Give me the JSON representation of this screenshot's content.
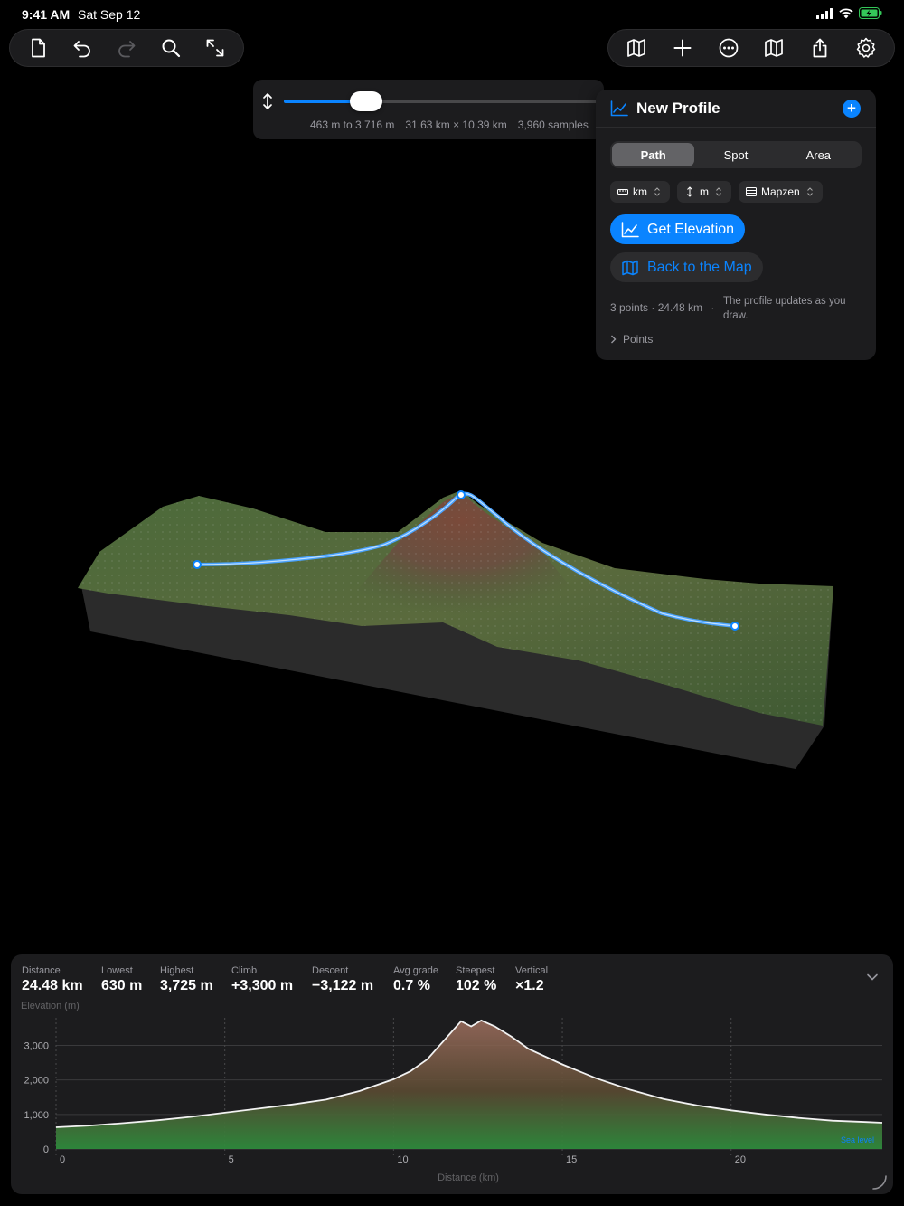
{
  "status_bar": {
    "time": "9:41 AM",
    "date": "Sat Sep 12"
  },
  "toolbar_left": {
    "icons": [
      "document-icon",
      "undo-icon",
      "redo-icon",
      "search-icon",
      "expand-icon"
    ]
  },
  "toolbar_right": {
    "icons": [
      "map-icon",
      "add-icon",
      "more-icon",
      "map-icon",
      "share-icon",
      "settings-icon"
    ]
  },
  "exaggeration": {
    "level": 0.21,
    "range": "463 m to 3,716 m",
    "extent": "31.63 km × 10.39 km",
    "samples": "3,960 samples"
  },
  "profile_panel": {
    "title": "New Profile",
    "segments": [
      "Path",
      "Spot",
      "Area"
    ],
    "active_segment": "Path",
    "pickers": {
      "distance_unit": "km",
      "height_unit": "m",
      "source": "Mapzen"
    },
    "get_elevation_label": "Get Elevation",
    "back_to_map_label": "Back to the Map",
    "summary": "3 points · 24.48 km",
    "separator": "·",
    "note": "The profile updates as you draw.",
    "points_label": "Points"
  },
  "stats": {
    "distance": {
      "label": "Distance",
      "value": "24.48 km"
    },
    "lowest": {
      "label": "Lowest",
      "value": "630 m"
    },
    "highest": {
      "label": "Highest",
      "value": "3,725 m"
    },
    "climb": {
      "label": "Climb",
      "value": "+3,300 m"
    },
    "descent": {
      "label": "Descent",
      "value": "−3,122 m"
    },
    "avg_grade": {
      "label": "Avg grade",
      "value": "0.7 %"
    },
    "steepest": {
      "label": "Steepest",
      "value": "102 %"
    },
    "vertical": {
      "label": "Vertical",
      "value": "×1.2"
    }
  },
  "chart_data": {
    "type": "area",
    "title": "",
    "ylabel": "Elevation (m)",
    "xlabel": "Distance (km)",
    "xlim": [
      0,
      24.48
    ],
    "ylim": [
      0,
      3800
    ],
    "x_ticks": [
      0,
      5,
      10,
      15,
      20
    ],
    "y_ticks": [
      0,
      1000,
      2000,
      3000
    ],
    "x_tick_labels": [
      "0",
      "5",
      "10",
      "15",
      "20"
    ],
    "y_tick_labels": [
      "0",
      "1,000",
      "2,000",
      "3,000"
    ],
    "grid": true,
    "annotation": "Sea level",
    "x": [
      0,
      1,
      2,
      3,
      4,
      5,
      6,
      7,
      8,
      9,
      10,
      10.5,
      11,
      11.5,
      12,
      12.3,
      12.6,
      13,
      13.5,
      14,
      15,
      16,
      17,
      18,
      19,
      20,
      21,
      22,
      23,
      24,
      24.48
    ],
    "series": [
      {
        "values": [
          630,
          680,
          750,
          830,
          930,
          1050,
          1170,
          1290,
          1430,
          1680,
          2020,
          2250,
          2600,
          3150,
          3700,
          3550,
          3725,
          3550,
          3250,
          2900,
          2450,
          2050,
          1720,
          1450,
          1260,
          1120,
          1000,
          900,
          820,
          780,
          760
        ]
      }
    ]
  }
}
